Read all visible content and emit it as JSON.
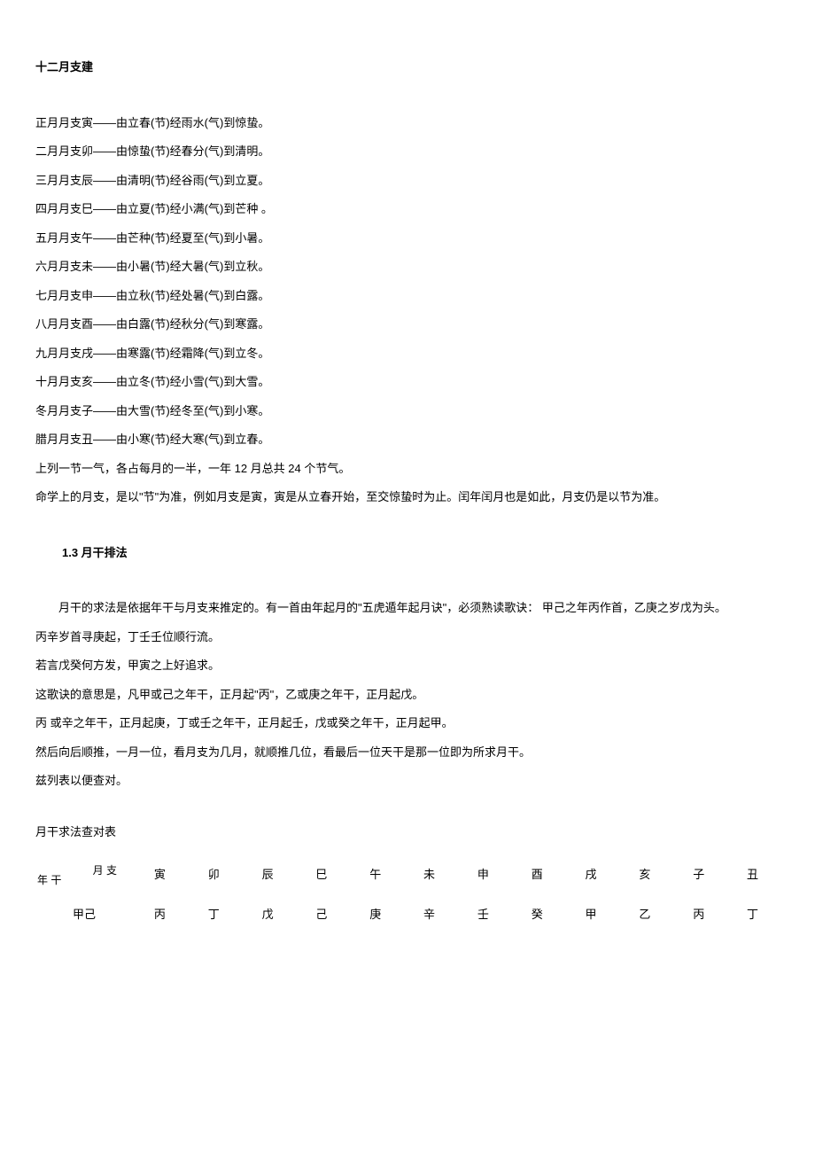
{
  "heading1": "十二月支建",
  "para1": "正月月支寅——由立春(节)经雨水(气)到惊蛰。",
  "para2": "二月月支卯——由惊蛰(节)经春分(气)到清明。",
  "para3": "三月月支辰——由清明(节)经谷雨(气)到立夏。",
  "para4": "四月月支巳——由立夏(节)经小满(气)到芒种 。",
  "para5": "五月月支午——由芒种(节)经夏至(气)到小暑。",
  "para6": "六月月支未——由小暑(节)经大暑(气)到立秋。",
  "para7": "七月月支申——由立秋(节)经处暑(气)到白露。",
  "para8": "八月月支酉——由白露(节)经秋分(气)到寒露。",
  "para9": "九月月支戌——由寒露(节)经霜降(气)到立冬。",
  "para10": "十月月支亥——由立冬(节)经小雪(气)到大雪。",
  "para11": "冬月月支子——由大雪(节)经冬至(气)到小寒。",
  "para12": "腊月月支丑——由小寒(节)经大寒(气)到立春。",
  "para13": "上列一节一气，各占每月的一半，一年 12 月总共 24 个节气。",
  "para14": "命学上的月支，是以\"节\"为准，例如月支是寅，寅是从立春开始，至交惊蛰时为止。闰年闰月也是如此，月支仍是以节为准。",
  "heading2": "1.3 月干排法",
  "para15": "月干的求法是依据年干与月支来推定的。有一首由年起月的\"五虎遁年起月诀\"，必须熟读歌诀：  甲己之年丙作首，乙庚之岁戊为头。",
  "para16": "丙辛岁首寻庚起，丁壬壬位顺行流。",
  "para17": "若言戊癸何方发，甲寅之上好追求。",
  "para18": "这歌诀的意思是，凡甲或己之年干，正月起\"丙\"，乙或庚之年干，正月起戊。",
  "para19": "丙 或辛之年干，正月起庚，丁或壬之年干，正月起壬，戊或癸之年干，正月起甲。",
  "para20": "然后向后顺推，一月一位，看月支为几月，就顺推几位，看最后一位天干是那一位即为所求月干。",
  "para21": "兹列表以便查对。",
  "tableTitle": "月干求法查对表",
  "diagTop": "月 支",
  "diagBot": "年 干",
  "headers": [
    "寅",
    "卯",
    "辰",
    "巳",
    "午",
    "未",
    "申",
    "酉",
    "戌",
    "亥",
    "子",
    "丑"
  ],
  "row1Label": "甲己",
  "row1": [
    "丙",
    "丁",
    "戊",
    "己",
    "庚",
    "辛",
    "壬",
    "癸",
    "甲",
    "乙",
    "丙",
    "丁"
  ]
}
